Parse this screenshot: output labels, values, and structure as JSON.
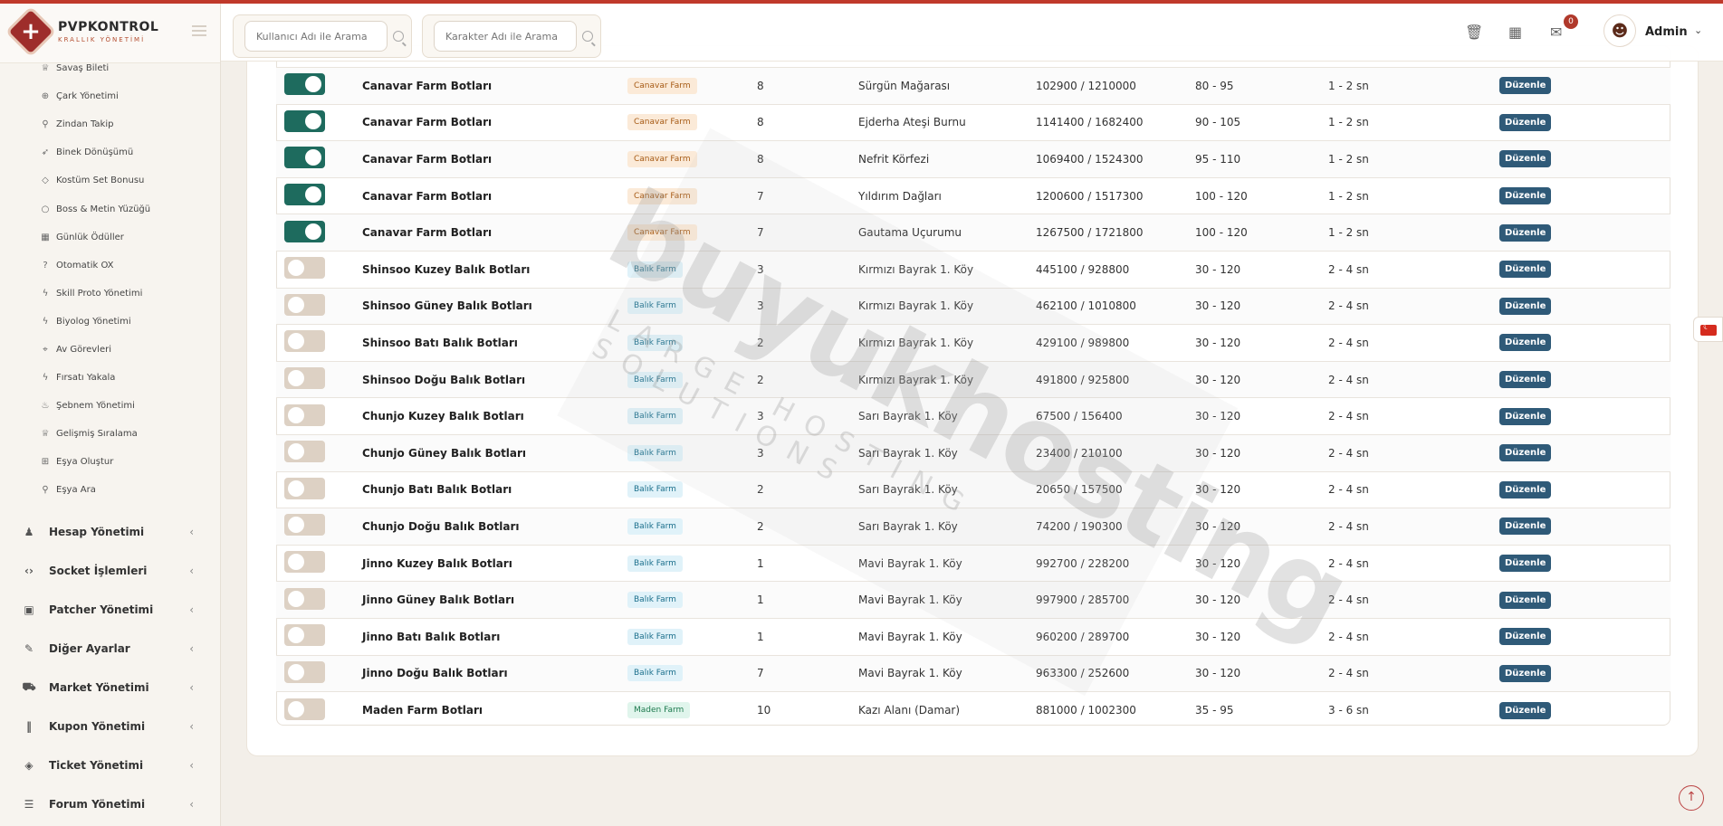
{
  "brand": {
    "title": "PVPKONTROL",
    "subtitle": "KRALLIK YÖNETİMİ"
  },
  "header": {
    "search_user_placeholder": "Kullanıcı Adı ile Arama",
    "search_char_placeholder": "Karakter Adı ile Arama",
    "notification_count": "0",
    "user_name": "Admin"
  },
  "sidebar": {
    "sub_items": [
      {
        "label": "Savaş Bileti",
        "icon": "trophy-icon"
      },
      {
        "label": "Çark Yönetimi",
        "icon": "globe-icon"
      },
      {
        "label": "Zindan Takip",
        "icon": "map-pin-icon"
      },
      {
        "label": "Binek Dönüşümü",
        "icon": "rocket-icon"
      },
      {
        "label": "Kostüm Set Bonusu",
        "icon": "diamond-icon"
      },
      {
        "label": "Boss & Metin Yüzüğü",
        "icon": "circle-icon"
      },
      {
        "label": "Günlük Ödüller",
        "icon": "calendar-icon"
      },
      {
        "label": "Otomatik OX",
        "icon": "question-icon"
      },
      {
        "label": "Skill Proto Yönetimi",
        "icon": "bolt-icon"
      },
      {
        "label": "Biyolog Yönetimi",
        "icon": "bolt-icon"
      },
      {
        "label": "Av Görevleri",
        "icon": "crosshair-icon"
      },
      {
        "label": "Fırsatı Yakala",
        "icon": "bolt-icon"
      },
      {
        "label": "Şebnem Yönetimi",
        "icon": "flame-icon"
      },
      {
        "label": "Gelişmiş Sıralama",
        "icon": "trophy-icon"
      },
      {
        "label": "Eşya Oluştur",
        "icon": "gift-icon"
      },
      {
        "label": "Eşya Ara",
        "icon": "search-icon"
      }
    ],
    "menu_items": [
      {
        "label": "Hesap Yönetimi",
        "icon": "users-icon"
      },
      {
        "label": "Socket İşlemleri",
        "icon": "code-icon"
      },
      {
        "label": "Patcher Yönetimi",
        "icon": "briefcase-icon"
      },
      {
        "label": "Diğer Ayarlar",
        "icon": "wrench-icon"
      },
      {
        "label": "Market Yönetimi",
        "icon": "cart-icon"
      },
      {
        "label": "Kupon Yönetimi",
        "icon": "barcode-icon"
      },
      {
        "label": "Ticket Yönetimi",
        "icon": "ticket-icon"
      },
      {
        "label": "Forum Yönetimi",
        "icon": "comments-icon"
      }
    ]
  },
  "table": {
    "edit_label": "Düzenle",
    "rows": [
      {
        "active": true,
        "name": "Canavar Farm Botları",
        "tag": "Canavar Farm",
        "tag_type": "canavar",
        "level": "8",
        "map": "Sürgün Mağarası",
        "coords": "102900 / 1210000",
        "range": "80 - 95",
        "delay": "1 - 2 sn"
      },
      {
        "active": true,
        "name": "Canavar Farm Botları",
        "tag": "Canavar Farm",
        "tag_type": "canavar",
        "level": "8",
        "map": "Ejderha Ateşi Burnu",
        "coords": "1141400 / 1682400",
        "range": "90 - 105",
        "delay": "1 - 2 sn"
      },
      {
        "active": true,
        "name": "Canavar Farm Botları",
        "tag": "Canavar Farm",
        "tag_type": "canavar",
        "level": "8",
        "map": "Nefrit Körfezi",
        "coords": "1069400 / 1524300",
        "range": "95 - 110",
        "delay": "1 - 2 sn"
      },
      {
        "active": true,
        "name": "Canavar Farm Botları",
        "tag": "Canavar Farm",
        "tag_type": "canavar",
        "level": "7",
        "map": "Yıldırım Dağları",
        "coords": "1200600 / 1517300",
        "range": "100 - 120",
        "delay": "1 - 2 sn"
      },
      {
        "active": true,
        "name": "Canavar Farm Botları",
        "tag": "Canavar Farm",
        "tag_type": "canavar",
        "level": "7",
        "map": "Gautama Uçurumu",
        "coords": "1267500 / 1721800",
        "range": "100 - 120",
        "delay": "1 - 2 sn"
      },
      {
        "active": false,
        "name": "Shinsoo Kuzey Balık Botları",
        "tag": "Balık Farm",
        "tag_type": "balik",
        "level": "3",
        "map": "Kırmızı Bayrak 1. Köy",
        "coords": "445100 / 928800",
        "range": "30 - 120",
        "delay": "2 - 4 sn"
      },
      {
        "active": false,
        "name": "Shinsoo Güney Balık Botları",
        "tag": "Balık Farm",
        "tag_type": "balik",
        "level": "3",
        "map": "Kırmızı Bayrak 1. Köy",
        "coords": "462100 / 1010800",
        "range": "30 - 120",
        "delay": "2 - 4 sn"
      },
      {
        "active": false,
        "name": "Shinsoo Batı Balık Botları",
        "tag": "Balık Farm",
        "tag_type": "balik",
        "level": "2",
        "map": "Kırmızı Bayrak 1. Köy",
        "coords": "429100 / 989800",
        "range": "30 - 120",
        "delay": "2 - 4 sn"
      },
      {
        "active": false,
        "name": "Shinsoo Doğu Balık Botları",
        "tag": "Balık Farm",
        "tag_type": "balik",
        "level": "2",
        "map": "Kırmızı Bayrak 1. Köy",
        "coords": "491800 / 925800",
        "range": "30 - 120",
        "delay": "2 - 4 sn"
      },
      {
        "active": false,
        "name": "Chunjo Kuzey Balık Botları",
        "tag": "Balık Farm",
        "tag_type": "balik",
        "level": "3",
        "map": "Sarı Bayrak 1. Köy",
        "coords": "67500 / 156400",
        "range": "30 - 120",
        "delay": "2 - 4 sn"
      },
      {
        "active": false,
        "name": "Chunjo Güney Balık Botları",
        "tag": "Balık Farm",
        "tag_type": "balik",
        "level": "3",
        "map": "Sarı Bayrak 1. Köy",
        "coords": "23400 / 210100",
        "range": "30 - 120",
        "delay": "2 - 4 sn"
      },
      {
        "active": false,
        "name": "Chunjo Batı Balık Botları",
        "tag": "Balık Farm",
        "tag_type": "balik",
        "level": "2",
        "map": "Sarı Bayrak 1. Köy",
        "coords": "20650 / 157500",
        "range": "30 - 120",
        "delay": "2 - 4 sn"
      },
      {
        "active": false,
        "name": "Chunjo Doğu Balık Botları",
        "tag": "Balık Farm",
        "tag_type": "balik",
        "level": "2",
        "map": "Sarı Bayrak 1. Köy",
        "coords": "74200 / 190300",
        "range": "30 - 120",
        "delay": "2 - 4 sn"
      },
      {
        "active": false,
        "name": "Jinno Kuzey Balık Botları",
        "tag": "Balık Farm",
        "tag_type": "balik",
        "level": "1",
        "map": "Mavi Bayrak 1. Köy",
        "coords": "992700 / 228200",
        "range": "30 - 120",
        "delay": "2 - 4 sn"
      },
      {
        "active": false,
        "name": "Jinno Güney Balık Botları",
        "tag": "Balık Farm",
        "tag_type": "balik",
        "level": "1",
        "map": "Mavi Bayrak 1. Köy",
        "coords": "997900 / 285700",
        "range": "30 - 120",
        "delay": "2 - 4 sn"
      },
      {
        "active": false,
        "name": "Jinno Batı Balık Botları",
        "tag": "Balık Farm",
        "tag_type": "balik",
        "level": "1",
        "map": "Mavi Bayrak 1. Köy",
        "coords": "960200 / 289700",
        "range": "30 - 120",
        "delay": "2 - 4 sn"
      },
      {
        "active": false,
        "name": "Jinno Doğu Balık Botları",
        "tag": "Balık Farm",
        "tag_type": "balik",
        "level": "7",
        "map": "Mavi Bayrak 1. Köy",
        "coords": "963300 / 252600",
        "range": "30 - 120",
        "delay": "2 - 4 sn"
      },
      {
        "active": false,
        "name": "Maden Farm Botları",
        "tag": "Maden Farm",
        "tag_type": "maden",
        "level": "10",
        "map": "Kazı Alanı (Damar)",
        "coords": "881000 / 1002300",
        "range": "35 - 95",
        "delay": "3 - 6 sn"
      }
    ]
  },
  "watermark": {
    "main": "buyukhosting",
    "sub": "LARGE HOSTING SOLUTIONS"
  },
  "colors": {
    "accent": "#9e2d2b",
    "toggle_on": "#1e6b5e",
    "edit_button": "#2f5a78"
  }
}
